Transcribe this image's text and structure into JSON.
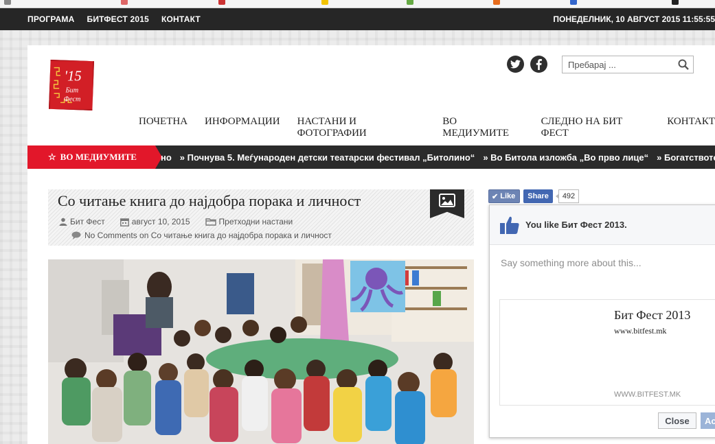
{
  "top_nav": {
    "items": [
      "ПРОГРАМА",
      "БИТФЕСТ 2015",
      "КОНТАКТ"
    ],
    "date": "ПОНЕДЕЛНИК, 10 АВГУСТ 2015 11:55:55"
  },
  "logo": {
    "year": "'15",
    "line1": "Бит",
    "line2": "Фест"
  },
  "search": {
    "placeholder": "Пребарај ..."
  },
  "main_nav": {
    "items": [
      "ПОЧЕТНА",
      "ИНФОРМАЦИИ",
      "НАСТАНИ И ФОТОГРАФИИ",
      "ВО МЕДИУМИТЕ",
      "СЛЕДНО НА БИТ ФЕСТ",
      "КОНТАКТ"
    ]
  },
  "ticker": {
    "label": "ВО МЕДИУМИТЕ",
    "items": [
      "но",
      "» Почнува 5. Меѓународен детски театарски фестивал „Битолино“",
      "» Во Битола изложба „Во прво лице“",
      "» Богатството на бито"
    ]
  },
  "article": {
    "title": "Со читање книга до најдобра порака и личност",
    "author": "Бит Фест",
    "date": "август 10, 2015",
    "category": "Претходни настани",
    "comments": "No Comments on Со читање книга до најдобра порака и личност"
  },
  "facebook": {
    "like_label": "Like",
    "share_label": "Share",
    "count": "492",
    "popup_title": "You like Бит Фест 2013.",
    "say_placeholder": "Say something more about this...",
    "card_name": "Бит Фест 2013",
    "card_url": "www.bitfest.mk",
    "card_domain": "WWW.BITFEST.MK",
    "close_label": "Close",
    "add_label": "Ac"
  },
  "colors": {
    "accent_red": "#e2172a",
    "dark_bar": "#262626",
    "fb_blue": "#4267b2"
  }
}
